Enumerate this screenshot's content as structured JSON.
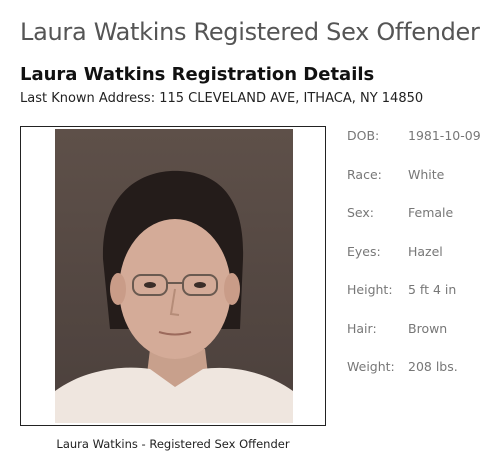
{
  "page": {
    "title": "Laura Watkins Registered Sex Offender"
  },
  "details": {
    "heading": "Laura Watkins Registration Details",
    "address": "Last Known Address: 115 CLEVELAND AVE, ITHACA, NY 14850"
  },
  "photo": {
    "caption": "Laura Watkins - Registered Sex Offender"
  },
  "facts": [
    {
      "label": "DOB:",
      "value": "1981-10-09"
    },
    {
      "label": "Race:",
      "value": "White"
    },
    {
      "label": "Sex:",
      "value": "Female"
    },
    {
      "label": "Eyes:",
      "value": "Hazel"
    },
    {
      "label": "Height:",
      "value": "5 ft 4 in"
    },
    {
      "label": "Hair:",
      "value": "Brown"
    },
    {
      "label": "Weight:",
      "value": "208 lbs."
    }
  ]
}
